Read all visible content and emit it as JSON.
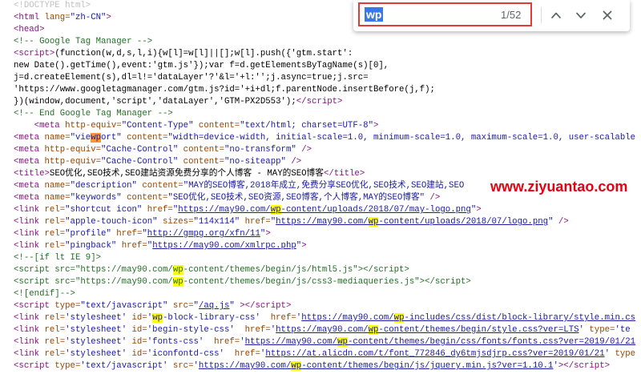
{
  "colors": {
    "tag": "#881280",
    "attr_name": "#994500",
    "attr_value": "#1a1aa6",
    "link": "#1a1aa6",
    "comment": "#236e25",
    "doctype": "#c0c0c0",
    "match": "#ffff00",
    "match_active": "#ff9632",
    "annotation": "#e53935",
    "selection": "#3b78e7",
    "watermark": "#e60012"
  },
  "find_bar": {
    "query": "wp",
    "match_count": "1/52",
    "prev_icon": "chevron-up-icon",
    "next_icon": "chevron-down-icon",
    "close_icon": "close-icon"
  },
  "watermark": "www.ziyuantao.com",
  "source_lines": [
    [
      [
        "d",
        "<!DOCTYPE html>"
      ]
    ],
    [
      [
        "t",
        "<html "
      ],
      [
        "a",
        "lang="
      ],
      [
        "v",
        "\"zh-CN\""
      ],
      [
        "t",
        ">"
      ]
    ],
    [
      [
        "t",
        "<head>"
      ]
    ],
    [
      [
        "c",
        "<!-- Google Tag Manager -->"
      ]
    ],
    [
      [
        "t",
        "<script>"
      ],
      [
        "x",
        "(function(w,d,s,l,i){w[l]=w[l]||[];w[l].push({'gtm.start':"
      ]
    ],
    [
      [
        "x",
        "new Date().getTime(),event:'gtm.js'});var f=d.getElementsByTagName(s)[0],"
      ]
    ],
    [
      [
        "x",
        "j=d.createElement(s),dl=l!='dataLayer'?'&l='+l:'';j.async=true;j.src="
      ]
    ],
    [
      [
        "x",
        "'https://www.googletagmanager.com/gtm.js?id='+i+dl;f.parentNode.insertBefore(j,f);"
      ]
    ],
    [
      [
        "x",
        "})(window,document,'script','dataLayer','GTM-PX2D553');"
      ],
      [
        "t",
        "</script>"
      ]
    ],
    [
      [
        "c",
        "<!-- End Google Tag Manager -->"
      ]
    ],
    [
      [
        "x",
        "    "
      ],
      [
        "t",
        "<meta "
      ],
      [
        "a",
        "http-equiv="
      ],
      [
        "v",
        "\"Content-Type\""
      ],
      [
        "a",
        " content="
      ],
      [
        "v",
        "\"text/html; charset=UTF-8\""
      ],
      [
        "t",
        ">"
      ]
    ],
    [
      [
        "t",
        "<meta "
      ],
      [
        "a",
        "name="
      ],
      [
        "v",
        "\"viewport\""
      ],
      [
        "a",
        " content="
      ],
      [
        "v",
        "\"width=device-width, initial-scale=1.0, minimum-scale=1.0, maximum-scale=1.0, user-scalable"
      ]
    ],
    [
      [
        "t",
        "<meta "
      ],
      [
        "a",
        "http-equiv="
      ],
      [
        "v",
        "\"Cache-Control\""
      ],
      [
        "a",
        " content="
      ],
      [
        "v",
        "\"no-transform\""
      ],
      [
        "t",
        " />"
      ]
    ],
    [
      [
        "t",
        "<meta "
      ],
      [
        "a",
        "http-equiv="
      ],
      [
        "v",
        "\"Cache-Control\""
      ],
      [
        "a",
        " content="
      ],
      [
        "v",
        "\"no-siteapp\""
      ],
      [
        "t",
        " />"
      ]
    ],
    [
      [
        "t",
        "<title>"
      ],
      [
        "x",
        "SEO优化,SEO技术,SEO建站资源免费分享的个人博客 - MAY的SEO博客"
      ],
      [
        "t",
        "</title>"
      ]
    ],
    [
      [
        "t",
        "<meta "
      ],
      [
        "a",
        "name="
      ],
      [
        "v",
        "\"description\""
      ],
      [
        "a",
        " content="
      ],
      [
        "v",
        "\"MAY的SEO博客,2018年成立,免费分享SEO优化,SEO技术,SEO建站,SEO"
      ]
    ],
    [
      [
        "t",
        "<meta "
      ],
      [
        "a",
        "name="
      ],
      [
        "v",
        "\"keywords\""
      ],
      [
        "a",
        " content="
      ],
      [
        "v",
        "\"SEO优化,SEO技术,SEO资源,SEO博客,个人博客,MAY的SEO博客\""
      ],
      [
        "t",
        " />"
      ]
    ],
    [
      [
        "t",
        "<link "
      ],
      [
        "a",
        "rel="
      ],
      [
        "v",
        "\"shortcut icon\""
      ],
      [
        "a",
        " href="
      ],
      [
        "v",
        "\""
      ],
      [
        "l",
        "https://may90.com/wp-content/uploads/2018/07/may-logo.png"
      ],
      [
        "v",
        "\""
      ],
      [
        "t",
        ">"
      ]
    ],
    [
      [
        "t",
        "<link "
      ],
      [
        "a",
        "rel="
      ],
      [
        "v",
        "\"apple-touch-icon\""
      ],
      [
        "a",
        " sizes="
      ],
      [
        "v",
        "\"114x114\""
      ],
      [
        "a",
        " href="
      ],
      [
        "v",
        "\""
      ],
      [
        "l",
        "https://may90.com/wp-content/uploads/2018/07/logo.png"
      ],
      [
        "v",
        "\""
      ],
      [
        "t",
        " />"
      ]
    ],
    [
      [
        "t",
        "<link "
      ],
      [
        "a",
        "rel="
      ],
      [
        "v",
        "\"profile\""
      ],
      [
        "a",
        " href="
      ],
      [
        "v",
        "\""
      ],
      [
        "l",
        "http://gmpg.org/xfn/11"
      ],
      [
        "v",
        "\""
      ],
      [
        "t",
        ">"
      ]
    ],
    [
      [
        "t",
        "<link "
      ],
      [
        "a",
        "rel="
      ],
      [
        "v",
        "\"pingback\""
      ],
      [
        "a",
        " href="
      ],
      [
        "v",
        "\""
      ],
      [
        "l",
        "https://may90.com/xmlrpc.php"
      ],
      [
        "v",
        "\""
      ],
      [
        "t",
        ">"
      ]
    ],
    [
      [
        "c",
        "<!--[if lt IE 9]>"
      ]
    ],
    [
      [
        "c",
        "<script src=\"https://may90.com/wp-content/themes/begin/js/html5.js\"></script>"
      ]
    ],
    [
      [
        "c",
        "<script src=\"https://may90.com/wp-content/themes/begin/js/css3-mediaqueries.js\"></script>"
      ]
    ],
    [
      [
        "c",
        "<![endif]-->"
      ]
    ],
    [
      [
        "t",
        "<script "
      ],
      [
        "a",
        "type="
      ],
      [
        "v",
        "\"text/javascript\""
      ],
      [
        "a",
        " src="
      ],
      [
        "v",
        "\""
      ],
      [
        "l",
        "/aq.js"
      ],
      [
        "v",
        "\""
      ],
      [
        "t",
        " ></script>"
      ]
    ],
    [
      [
        "t",
        "<link "
      ],
      [
        "a",
        "rel="
      ],
      [
        "v",
        "'stylesheet'"
      ],
      [
        "a",
        " id="
      ],
      [
        "v",
        "'wp-block-library-css'"
      ],
      [
        "a",
        "  href="
      ],
      [
        "v",
        "'"
      ],
      [
        "l",
        "https://may90.com/wp-includes/css/dist/block-library/style.min.cs"
      ]
    ],
    [
      [
        "t",
        "<link "
      ],
      [
        "a",
        "rel="
      ],
      [
        "v",
        "'stylesheet'"
      ],
      [
        "a",
        " id="
      ],
      [
        "v",
        "'begin-style-css'"
      ],
      [
        "a",
        "  href="
      ],
      [
        "v",
        "'"
      ],
      [
        "l",
        "https://may90.com/wp-content/themes/begin/style.css?ver=LTS"
      ],
      [
        "v",
        "'"
      ],
      [
        "a",
        " type="
      ],
      [
        "v",
        "'te"
      ]
    ],
    [
      [
        "t",
        "<link "
      ],
      [
        "a",
        "rel="
      ],
      [
        "v",
        "'stylesheet'"
      ],
      [
        "a",
        " id="
      ],
      [
        "v",
        "'fonts-css'"
      ],
      [
        "a",
        "  href="
      ],
      [
        "v",
        "'"
      ],
      [
        "l",
        "https://may90.com/wp-content/themes/begin/css/fonts/fonts.css?ver=2019/01/21"
      ]
    ],
    [
      [
        "t",
        "<link "
      ],
      [
        "a",
        "rel="
      ],
      [
        "v",
        "'stylesheet'"
      ],
      [
        "a",
        " id="
      ],
      [
        "v",
        "'iconfontd-css'"
      ],
      [
        "a",
        "  href="
      ],
      [
        "v",
        "'"
      ],
      [
        "l",
        "https://at.alicdn.com/t/font_772846_dy6tmjsdjrp.css?ver=2019/01/21"
      ],
      [
        "v",
        "'"
      ],
      [
        "a",
        " type"
      ]
    ],
    [
      [
        "t",
        "<script "
      ],
      [
        "a",
        "type="
      ],
      [
        "v",
        "'text/javascript'"
      ],
      [
        "a",
        " src="
      ],
      [
        "v",
        "'"
      ],
      [
        "l",
        "https://may90.com/wp-content/themes/begin/js/jquery.min.js?ver=1.10.1"
      ],
      [
        "v",
        "'"
      ],
      [
        "t",
        "></script>"
      ]
    ]
  ]
}
